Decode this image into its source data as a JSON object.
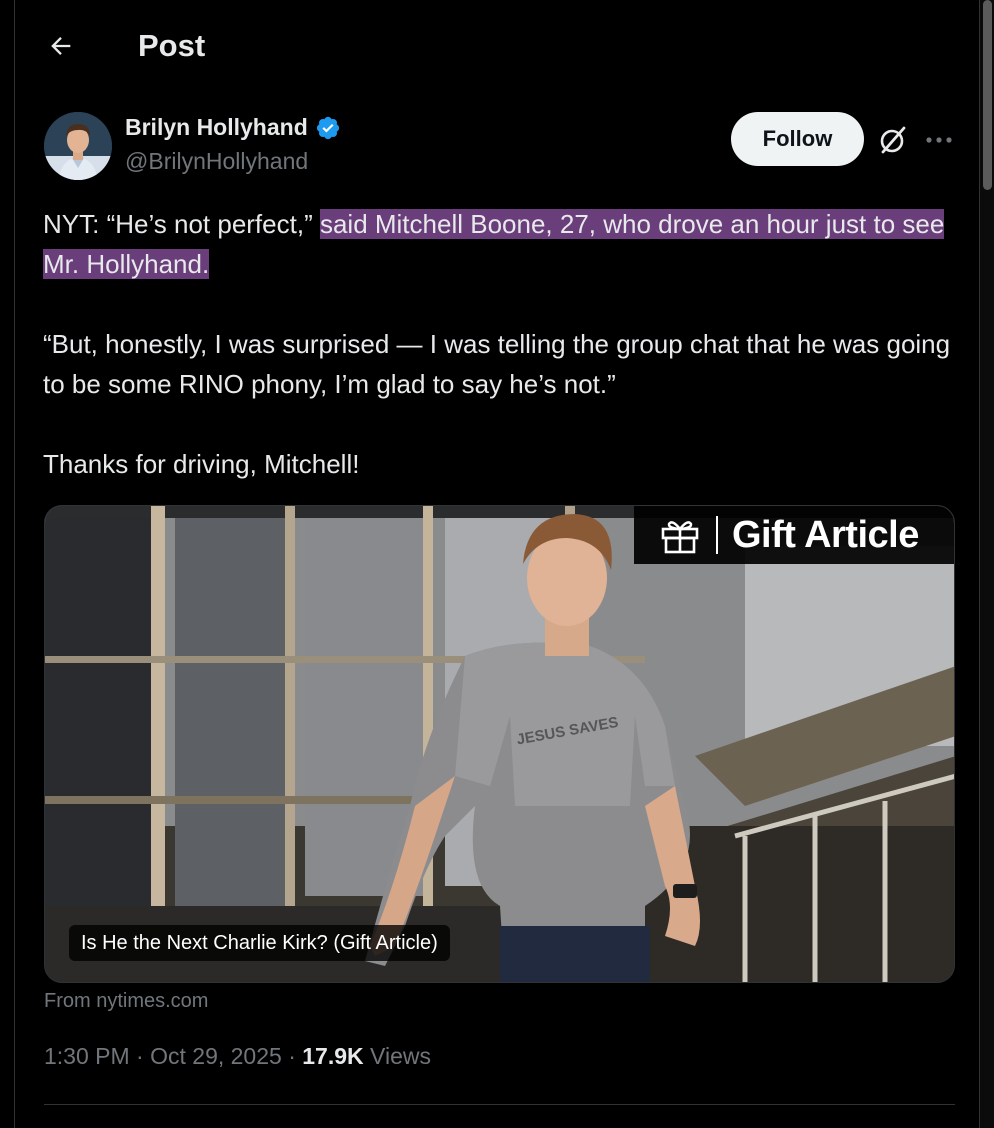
{
  "header": {
    "title": "Post",
    "back_icon": "arrow-left-icon"
  },
  "author": {
    "name": "Brilyn Hollyhand",
    "handle": "@BrilynHollyhand",
    "verified": true,
    "verified_color": "#1d9bf0"
  },
  "actions": {
    "follow_label": "Follow",
    "grok_icon": "grok-icon",
    "more_icon": "more-horizontal-icon"
  },
  "tweet": {
    "line1_plain": "NYT: “He’s not perfect,” ",
    "line1_highlight": "said Mitchell Boone, 27, who drove an hour just to see Mr. Hollyhand.",
    "paragraph2": "“But, honestly, I was surprised — I was telling the group chat that he was going to be some RINO phony, I’m glad to say he’s not.”",
    "paragraph3": "Thanks for driving, Mitchell!",
    "highlight_color": "#6a3d7b"
  },
  "card": {
    "gift_label": "Gift Article",
    "gift_icon": "gift-icon",
    "caption": "Is He the Next Charlie Kirk? (Gift Article)",
    "shirt_text": "JESUS SAVES",
    "source": "From nytimes.com"
  },
  "meta": {
    "time": "1:30 PM",
    "separator": " · ",
    "date": "Oct 29, 2025",
    "views_count": "17.9K",
    "views_label": " Views"
  },
  "colors": {
    "background": "#000000",
    "text_primary": "#e7e9ea",
    "text_secondary": "#71767b",
    "follow_bg": "#eff3f4",
    "border": "#2f3336"
  }
}
